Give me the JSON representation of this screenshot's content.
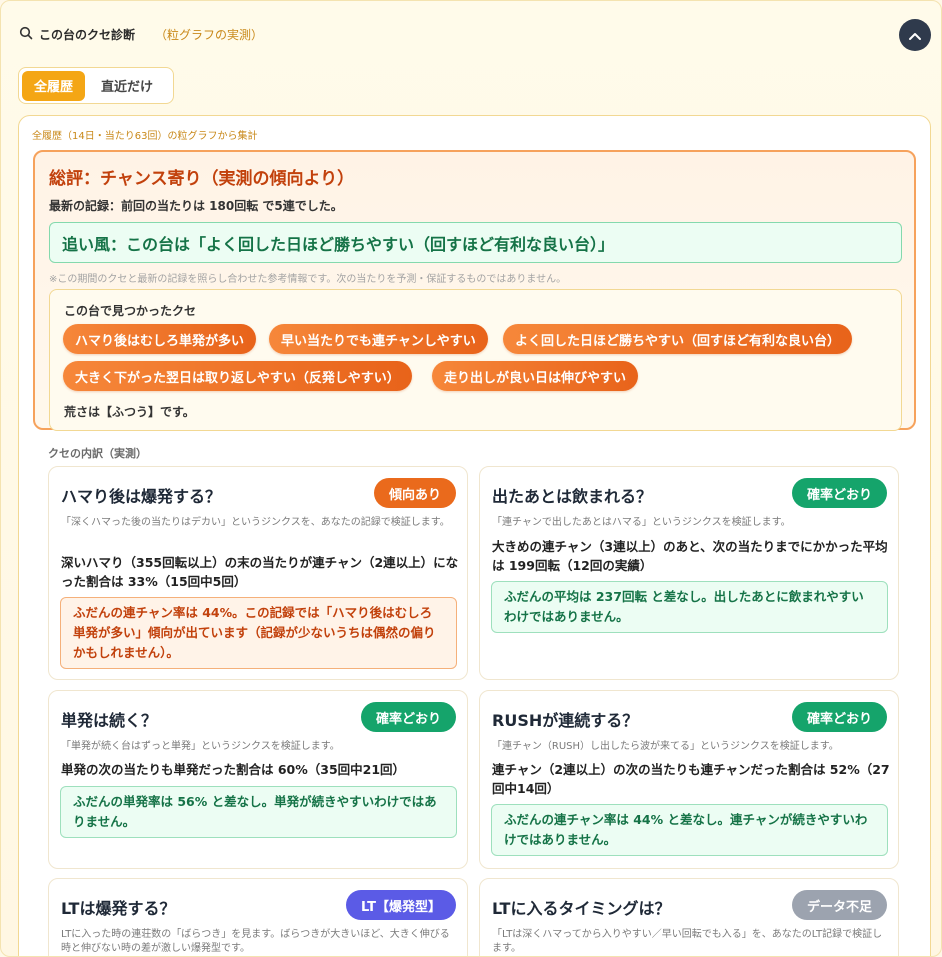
{
  "header": {
    "title": "この台のクセ診断",
    "subtitle": "（粒グラフの実測）"
  },
  "tabs": [
    {
      "label": "全履歴",
      "active": true
    },
    {
      "label": "直近だけ",
      "active": false
    }
  ],
  "caption": "全履歴（14日・当たり63回）の粒グラフから集計",
  "summary": {
    "title": "総評：チャンス寄り（実測の傾向より）",
    "latest": "最新の記録：前回の当たりは 180回転 で5連でした。",
    "tailwind": "追い風：この台は「よく回した日ほど勝ちやすい（回すほど有利な良い台）」",
    "disclaimer": "※この期間のクセと最新の記録を照らし合わせた参考情報です。次の当たりを予測・保証するものではありません。",
    "found_title": "この台で見つかったクセ",
    "chips": [
      "ハマり後はむしろ単発が多い",
      "早い当たりでも連チャンしやすい",
      "よく回した日ほど勝ちやすい（回すほど有利な良い台）",
      "大きく下がった翌日は取り返しやすい（反発しやすい）",
      "走り出しが良い日は伸びやすい"
    ],
    "roughness": "荒さは【ふつう】です。"
  },
  "breakdown_label": "クセの内訳（実測）",
  "cards": [
    {
      "title": "ハマり後は爆発する？",
      "badge": "傾向あり",
      "desc": "「深くハマった後の当たりはデカい」というジンクスを、あなたの記録で検証します。",
      "stat": "深いハマり（355回転以上）の末の当たりが連チャン（2連以上）になった割合は 33%（15回中5回）",
      "note": "ふだんの連チャン率は 44%。この記録では「ハマり後はむしろ単発が多い」傾向が出ています（記録が少ないうちは偶然の偏りかもしれません）。"
    },
    {
      "title": "出たあとは飲まれる？",
      "badge": "確率どおり",
      "desc": "「連チャンで出したあとはハマる」というジンクスを検証します。",
      "stat": "大きめの連チャン（3連以上）のあと、次の当たりまでにかかった平均は 199回転（12回の実績）",
      "note": "ふだんの平均は 237回転 と差なし。出したあとに飲まれやすいわけではありません。"
    },
    {
      "title": "単発は続く？",
      "badge": "確率どおり",
      "desc": "「単発が続く台はずっと単発」というジンクスを検証します。",
      "stat": "単発の次の当たりも単発だった割合は 60%（35回中21回）",
      "note": "ふだんの単発率は 56% と差なし。単発が続きやすいわけではありません。"
    },
    {
      "title": "RUSHが連続する？",
      "badge": "確率どおり",
      "desc": "「連チャン（RUSH）し出したら波が来てる」というジンクスを検証します。",
      "stat": "連チャン（2連以上）の次の当たりも連チャンだった割合は 52%（27回中14回）",
      "note": "ふだんの連チャン率は 44% と差なし。連チャンが続きやすいわけではありません。"
    },
    {
      "title": "LTは爆発する？",
      "badge": "LT【爆発型】",
      "desc": "LTに入った時の連荘数の「ばらつき」を見ます。ばらつきが大きいほど、大きく伸びる時と伸びない時の差が激しい爆発型です。"
    },
    {
      "title": "LTに入るタイミングは？",
      "badge": "データ不足",
      "desc": "「LTは深くハマってから入りやすい／早い回転でも入る」を、あなたのLT記録で検証します。"
    }
  ],
  "colors": {
    "accent": "#f4a615",
    "warn": "#ea6a1c",
    "ok": "#15a46b",
    "lt": "#5b5be6",
    "nodata": "#9ca3af"
  },
  "icons": {
    "header": "search-icon",
    "collapse": "chevron-up-icon"
  }
}
